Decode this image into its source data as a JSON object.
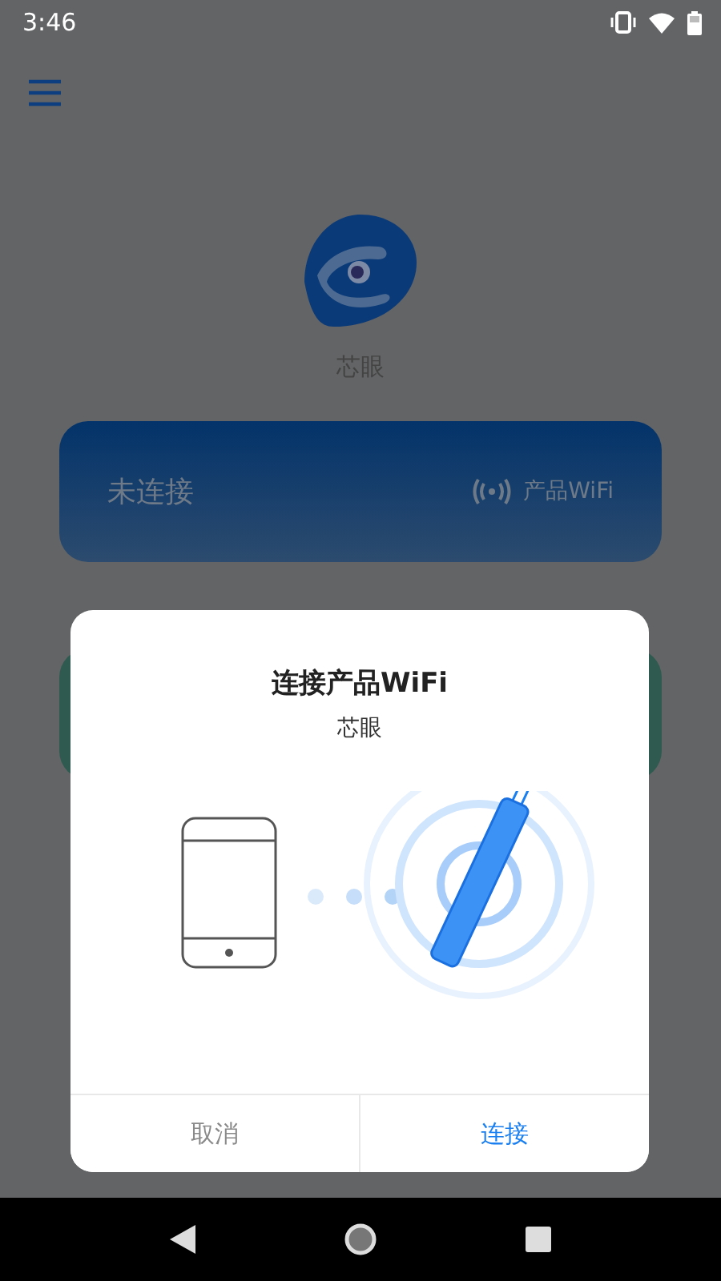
{
  "status_bar": {
    "time": "3:46"
  },
  "app": {
    "name": "芯眼"
  },
  "connection_card": {
    "status": "未连接",
    "network_label": "产品WiFi"
  },
  "dialog": {
    "title": "连接产品WiFi",
    "subtitle": "芯眼",
    "buttons": [
      {
        "label": "取消",
        "kind": "cancel"
      },
      {
        "label": "连接",
        "kind": "confirm"
      }
    ]
  }
}
